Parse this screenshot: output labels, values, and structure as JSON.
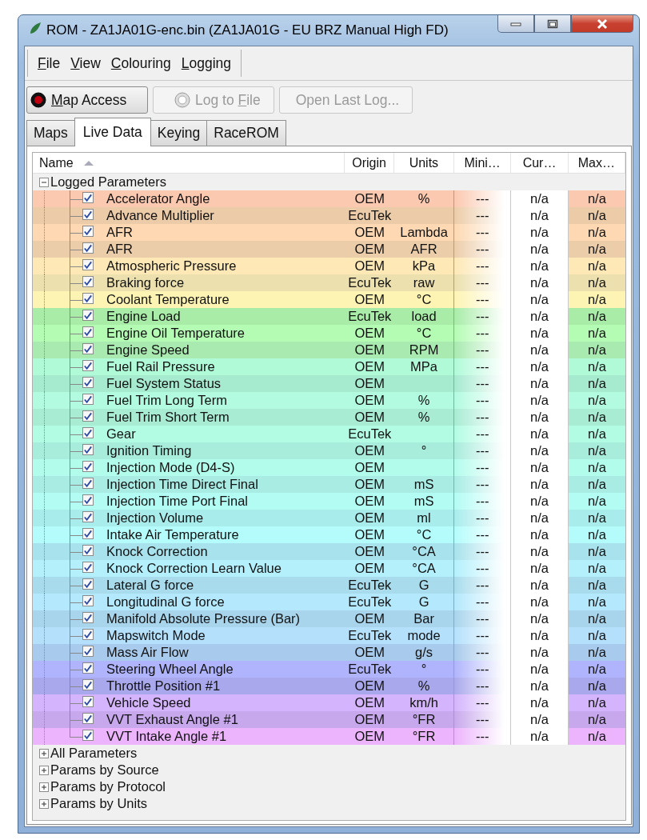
{
  "window": {
    "title": "ROM - ZA1JA01G-enc.bin (ZA1JA01G - EU BRZ Manual High FD)"
  },
  "menu": [
    {
      "access_key": "F",
      "label_after": "ile"
    },
    {
      "access_key": "V",
      "label_after": "iew"
    },
    {
      "access_key": "C",
      "label_after": "olouring"
    },
    {
      "access_key": "L",
      "label_after": "ogging"
    }
  ],
  "toolbar": [
    {
      "access_key": "M",
      "label_after": "ap Access",
      "kind": "record",
      "disabled": false
    },
    {
      "label_before": "Log to ",
      "access_key": "F",
      "label_after": "ile",
      "kind": "record",
      "disabled": true
    },
    {
      "label_before": "Open Last Log...",
      "kind": "plain",
      "disabled": true
    }
  ],
  "tabs": [
    {
      "label": "Maps",
      "selected": false
    },
    {
      "label": "Live Data",
      "selected": true
    },
    {
      "label": "Keying",
      "selected": false
    },
    {
      "label": "RaceROM",
      "selected": false
    }
  ],
  "table": {
    "columns": [
      {
        "label": "Name",
        "sorted": true
      },
      {
        "label": "Origin",
        "sorted": false
      },
      {
        "label": "Units",
        "sorted": false
      },
      {
        "label": "Mini…",
        "sorted": false
      },
      {
        "label": "Cur…",
        "sorted": false
      },
      {
        "label": "Max…",
        "sorted": false
      }
    ],
    "groups": [
      {
        "label": "Logged Parameters",
        "expanded": true,
        "children": [
          {
            "name": "Accelerator Angle",
            "origin": "OEM",
            "units": "%",
            "minimum": "---",
            "current": "n/a",
            "maximum": "n/a",
            "checked": true,
            "color": "#fbc8b0"
          },
          {
            "name": "Advance Multiplier",
            "origin": "EcuTek",
            "minimum": "---",
            "current": "n/a",
            "maximum": "n/a",
            "checked": true,
            "color": "#eccca8"
          },
          {
            "name": "AFR",
            "origin": "OEM",
            "units": "Lambda",
            "minimum": "---",
            "current": "n/a",
            "maximum": "n/a",
            "checked": true,
            "color": "#fdd8b2"
          },
          {
            "name": "AFR",
            "origin": "OEM",
            "units": "AFR",
            "minimum": "---",
            "current": "n/a",
            "maximum": "n/a",
            "checked": true,
            "color": "#eccdaa"
          },
          {
            "name": "Atmospheric Pressure",
            "origin": "OEM",
            "units": "kPa",
            "minimum": "---",
            "current": "n/a",
            "maximum": "n/a",
            "checked": true,
            "color": "#fde8b6"
          },
          {
            "name": "Braking force",
            "origin": "EcuTek",
            "units": "raw",
            "minimum": "---",
            "current": "n/a",
            "maximum": "n/a",
            "checked": true,
            "color": "#ece0ae"
          },
          {
            "name": "Coolant Temperature",
            "origin": "OEM",
            "units": "°C",
            "minimum": "---",
            "current": "n/a",
            "maximum": "n/a",
            "checked": true,
            "color": "#fdf4b4"
          },
          {
            "name": "Engine Load",
            "origin": "EcuTek",
            "units": "load",
            "minimum": "---",
            "current": "n/a",
            "maximum": "n/a",
            "checked": true,
            "color": "#a8eca8"
          },
          {
            "name": "Engine Oil Temperature",
            "origin": "OEM",
            "units": "°C",
            "minimum": "---",
            "current": "n/a",
            "maximum": "n/a",
            "checked": true,
            "color": "#b4fbb4"
          },
          {
            "name": "Engine Speed",
            "origin": "OEM",
            "units": "RPM",
            "minimum": "---",
            "current": "n/a",
            "maximum": "n/a",
            "checked": true,
            "color": "#a8eab0"
          },
          {
            "name": "Fuel Rail Pressure",
            "origin": "OEM",
            "units": "MPa",
            "minimum": "---",
            "current": "n/a",
            "maximum": "n/a",
            "checked": true,
            "color": "#b0fad8"
          },
          {
            "name": "Fuel System Status",
            "origin": "OEM",
            "minimum": "---",
            "current": "n/a",
            "maximum": "n/a",
            "checked": true,
            "color": "#a6ead0"
          },
          {
            "name": "Fuel Trim Long Term",
            "origin": "OEM",
            "units": "%",
            "minimum": "---",
            "current": "n/a",
            "maximum": "n/a",
            "checked": true,
            "color": "#b2fbe0"
          },
          {
            "name": "Fuel Trim Short Term",
            "origin": "OEM",
            "units": "%",
            "minimum": "---",
            "current": "n/a",
            "maximum": "n/a",
            "checked": true,
            "color": "#a8ecd4"
          },
          {
            "name": "Gear",
            "origin": "EcuTek",
            "minimum": "---",
            "current": "n/a",
            "maximum": "n/a",
            "checked": true,
            "color": "#b2fce4"
          },
          {
            "name": "Ignition Timing",
            "origin": "OEM",
            "units": "°",
            "minimum": "---",
            "current": "n/a",
            "maximum": "n/a",
            "checked": true,
            "color": "#a8ecdc"
          },
          {
            "name": "Injection Mode (D4-S)",
            "origin": "OEM",
            "minimum": "---",
            "current": "n/a",
            "maximum": "n/a",
            "checked": true,
            "color": "#b2fcec"
          },
          {
            "name": "Injection Time Direct Final",
            "origin": "OEM",
            "units": "mS",
            "minimum": "---",
            "current": "n/a",
            "maximum": "n/a",
            "checked": true,
            "color": "#a8ece4"
          },
          {
            "name": "Injection Time Port Final",
            "origin": "OEM",
            "units": "mS",
            "minimum": "---",
            "current": "n/a",
            "maximum": "n/a",
            "checked": true,
            "color": "#b2fcf4"
          },
          {
            "name": "Injection Volume",
            "origin": "OEM",
            "units": "ml",
            "minimum": "---",
            "current": "n/a",
            "maximum": "n/a",
            "checked": true,
            "color": "#a8ecec"
          },
          {
            "name": "Intake Air Temperature",
            "origin": "OEM",
            "units": "°C",
            "minimum": "---",
            "current": "n/a",
            "maximum": "n/a",
            "checked": true,
            "color": "#b4fcfc"
          },
          {
            "name": "Knock Correction",
            "origin": "OEM",
            "units": "°CA",
            "minimum": "---",
            "current": "n/a",
            "maximum": "n/a",
            "checked": true,
            "color": "#a8e2ec"
          },
          {
            "name": "Knock Correction Learn Value",
            "origin": "OEM",
            "units": "°CA",
            "minimum": "---",
            "current": "n/a",
            "maximum": "n/a",
            "checked": true,
            "color": "#b4f0fc"
          },
          {
            "name": "Lateral G force",
            "origin": "EcuTek",
            "units": "G",
            "minimum": "---",
            "current": "n/a",
            "maximum": "n/a",
            "checked": true,
            "color": "#a8dcec"
          },
          {
            "name": "Longitudinal G force",
            "origin": "EcuTek",
            "units": "G",
            "minimum": "---",
            "current": "n/a",
            "maximum": "n/a",
            "checked": true,
            "color": "#b4e8fc"
          },
          {
            "name": "Manifold Absolute Pressure (Bar)",
            "origin": "OEM",
            "units": "Bar",
            "minimum": "---",
            "current": "n/a",
            "maximum": "n/a",
            "checked": true,
            "color": "#a8d4ec"
          },
          {
            "name": "Mapswitch Mode",
            "origin": "EcuTek",
            "units": "mode",
            "minimum": "---",
            "current": "n/a",
            "maximum": "n/a",
            "checked": true,
            "color": "#b4e0fc"
          },
          {
            "name": "Mass Air Flow",
            "origin": "OEM",
            "units": "g/s",
            "minimum": "---",
            "current": "n/a",
            "maximum": "n/a",
            "checked": true,
            "color": "#a8caec"
          },
          {
            "name": "Steering Wheel Angle",
            "origin": "EcuTek",
            "units": "°",
            "minimum": "---",
            "current": "n/a",
            "maximum": "n/a",
            "checked": true,
            "color": "#b0b4fc"
          },
          {
            "name": "Throttle Position #1",
            "origin": "OEM",
            "units": "%",
            "minimum": "---",
            "current": "n/a",
            "maximum": "n/a",
            "checked": true,
            "color": "#aaa8ec"
          },
          {
            "name": "Vehicle Speed",
            "origin": "OEM",
            "units": "km/h",
            "minimum": "---",
            "current": "n/a",
            "maximum": "n/a",
            "checked": true,
            "color": "#d4b4fc"
          },
          {
            "name": "VVT Exhaust Angle #1",
            "origin": "OEM",
            "units": "°FR",
            "minimum": "---",
            "current": "n/a",
            "maximum": "n/a",
            "checked": true,
            "color": "#c8a8ec"
          },
          {
            "name": "VVT Intake Angle #1",
            "origin": "OEM",
            "units": "°FR",
            "minimum": "---",
            "current": "n/a",
            "maximum": "n/a",
            "checked": true,
            "color": "#ecb4fc"
          }
        ]
      },
      {
        "label": "All Parameters",
        "expanded": false
      },
      {
        "label": "Params by Source",
        "expanded": false
      },
      {
        "label": "Params by Protocol",
        "expanded": false
      },
      {
        "label": "Params by Units",
        "expanded": false
      }
    ]
  }
}
